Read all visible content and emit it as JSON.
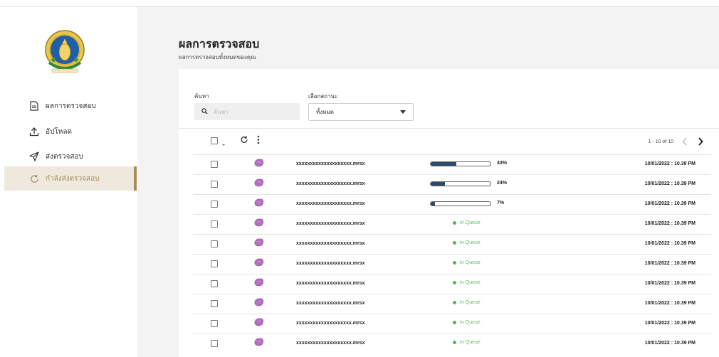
{
  "sidebar": {
    "logo_icon": "institution-seal-logo",
    "items": [
      {
        "label": "ผลการตรวจสอบ",
        "icon": "document-icon"
      },
      {
        "label": "อัปโหลด",
        "icon": "upload-icon"
      },
      {
        "label": "ส่งตรวจสอบ",
        "icon": "send-icon"
      },
      {
        "label": "กำลังส่งตรวจสอบ",
        "icon": "refresh-icon",
        "active": true
      }
    ]
  },
  "header": {
    "title": "ผลการตรวจสอบ",
    "subtitle": "ผลการตรวจสอบทั้งหมดของคุณ"
  },
  "filters": {
    "search_label": "ค้นหา",
    "search_placeholder": "ค้นหา",
    "status_label": "เลือกสถานะ",
    "status_value": "ทั้งหมด"
  },
  "toolbar": {
    "pagination": "1 - 10 of 10"
  },
  "colors": {
    "accent": "#a88b5b",
    "active_bg": "#efe9dd",
    "progress": "#2b4a6b",
    "queue": "#4cbb4c",
    "thumb": "#b36ec0"
  },
  "rows": [
    {
      "filename": "xxxxxxxxxxxxxxxxxxxx.mrsx",
      "status": "progress",
      "progress": 43,
      "progress_label": "43%",
      "date": "10/01/2022 : 10.39 PM"
    },
    {
      "filename": "xxxxxxxxxxxxxxxxxxxx.mrsx",
      "status": "progress",
      "progress": 24,
      "progress_label": "24%",
      "date": "10/01/2022 : 10.39 PM"
    },
    {
      "filename": "xxxxxxxxxxxxxxxxxxxx.mrsx",
      "status": "progress",
      "progress": 7,
      "progress_label": "7%",
      "date": "10/01/2022 : 10.39 PM"
    },
    {
      "filename": "xxxxxxxxxxxxxxxxxxxx.mrsx",
      "status": "queue",
      "queue_label": "In Queue",
      "date": "10/01/2022 : 10.39 PM"
    },
    {
      "filename": "xxxxxxxxxxxxxxxxxxxx.mrsx",
      "status": "queue",
      "queue_label": "In Queue",
      "date": "10/01/2022 : 10.39 PM"
    },
    {
      "filename": "xxxxxxxxxxxxxxxxxxxx.mrsx",
      "status": "queue",
      "queue_label": "In Queue",
      "date": "10/01/2022 : 10.39 PM"
    },
    {
      "filename": "xxxxxxxxxxxxxxxxxxxx.mrsx",
      "status": "queue",
      "queue_label": "In Queue",
      "date": "10/01/2022 : 10.39 PM"
    },
    {
      "filename": "xxxxxxxxxxxxxxxxxxxx.mrsx",
      "status": "queue",
      "queue_label": "In Queue",
      "date": "10/01/2022 : 10.39 PM"
    },
    {
      "filename": "xxxxxxxxxxxxxxxxxxxx.mrsx",
      "status": "queue",
      "queue_label": "In Queue",
      "date": "10/01/2022 : 10.39 PM"
    },
    {
      "filename": "xxxxxxxxxxxxxxxxxxxx.mrsx",
      "status": "queue",
      "queue_label": "In Queue",
      "date": "10/01/2022 : 10.39 PM"
    }
  ]
}
